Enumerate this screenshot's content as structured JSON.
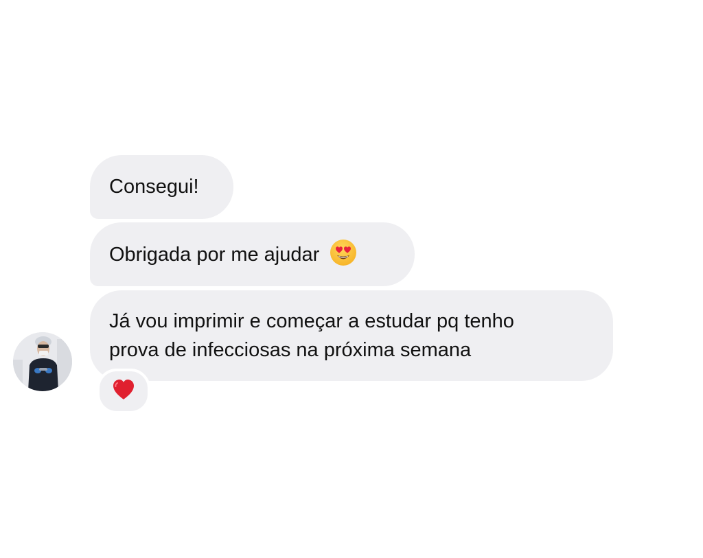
{
  "conversation": {
    "messages": [
      {
        "text": "Consegui!"
      },
      {
        "text": "Obrigada por me ajudar",
        "emoji": "heart-eyes-emoji"
      },
      {
        "lines": [
          "Já vou imprimir e começar a estudar pq tenho",
          "prova de infecciosas na próxima semana"
        ]
      }
    ],
    "reaction": {
      "emoji": "red-heart-emoji"
    },
    "avatar": {
      "icon": "profile-photo"
    }
  },
  "colors": {
    "bubble": "#efeff2",
    "text": "#111111",
    "heart": "#e0202f",
    "background": "#ffffff"
  }
}
